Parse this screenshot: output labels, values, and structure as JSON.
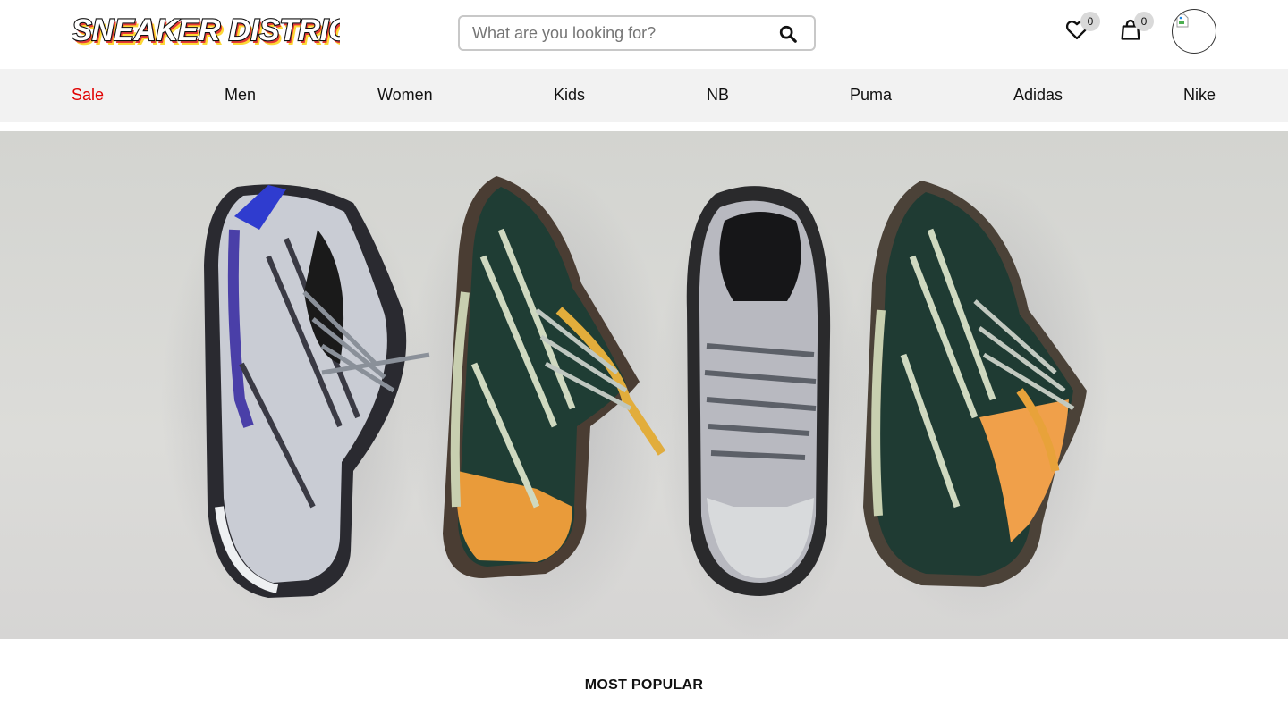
{
  "brand": {
    "logo_text": "SNEAKER DISTRICT",
    "colors": [
      "#111111",
      "#e53935",
      "#1e88e5",
      "#fdd835",
      "#43a047"
    ]
  },
  "search": {
    "placeholder": "What are you looking for?",
    "icon": "search-icon"
  },
  "header": {
    "wishlist_count": "0",
    "cart_count": "0",
    "wishlist_icon": "heart-icon",
    "cart_icon": "shopping-bag-icon",
    "avatar_icon": "user-avatar"
  },
  "nav": {
    "items": [
      {
        "label": "Sale",
        "highlight": "#e00000"
      },
      {
        "label": "Men"
      },
      {
        "label": "Women"
      },
      {
        "label": "Kids"
      },
      {
        "label": "NB"
      },
      {
        "label": "Puma"
      },
      {
        "label": "Adidas"
      },
      {
        "label": "Nike"
      }
    ]
  },
  "hero": {
    "image": "four trail running sneakers on a light grey background"
  },
  "sections": {
    "most_popular": "MOST POPULAR"
  }
}
